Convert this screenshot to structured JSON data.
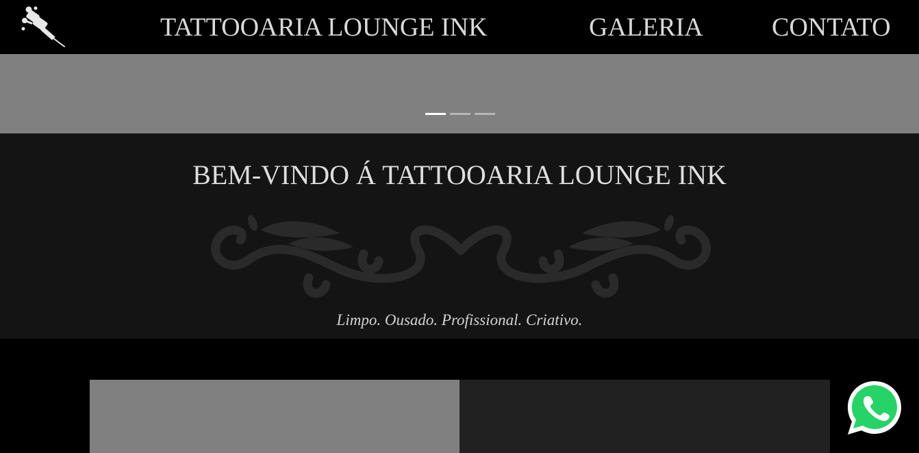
{
  "nav": {
    "logo_icon": "tattoo-machine-icon",
    "brand": "TATTOOARIA LOUNGE INK",
    "links": [
      "GALERIA",
      "CONTATO"
    ]
  },
  "carousel": {
    "slide_count": 3,
    "active_slide": 1
  },
  "welcome": {
    "title": "BEM-VINDO Á TATTOOARIA LOUNGE INK",
    "tagline": "Limpo. Ousado. Profissional. Criativo.",
    "ornament_icon": "flourish-ornament-icon"
  },
  "floating": {
    "whatsapp_icon": "whatsapp-icon"
  },
  "colors": {
    "nav_bg": "#000000",
    "text": "#d9d9d9",
    "carousel_bg": "#808080",
    "section_bg": "#141414",
    "ornament": "#2a2a2a",
    "card_left": "#808080",
    "card_right": "#212121",
    "whatsapp_green": "#25d366"
  }
}
